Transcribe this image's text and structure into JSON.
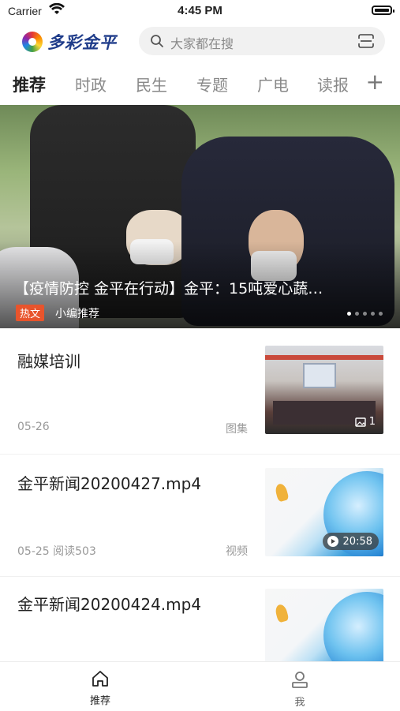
{
  "status": {
    "carrier": "Carrier",
    "time": "4:45 PM"
  },
  "header": {
    "logo_text": "多彩金平",
    "search_placeholder": "大家都在搜"
  },
  "tabs": [
    {
      "label": "推荐",
      "active": true
    },
    {
      "label": "时政"
    },
    {
      "label": "民生"
    },
    {
      "label": "专题"
    },
    {
      "label": "广电"
    },
    {
      "label": "读报"
    }
  ],
  "tab_add": "+",
  "banner": {
    "title": "【疫情防控 金平在行动】金平：15吨爱心蔬…",
    "badge": "热文",
    "source": "小编推荐"
  },
  "feed": [
    {
      "title": "融媒培训",
      "meta": "05-26",
      "type": "图集",
      "badge": "1"
    },
    {
      "title": "金平新闻20200427.mp4",
      "meta": "05-25  阅读503",
      "type": "视频",
      "duration": "20:58"
    },
    {
      "title": "金平新闻20200424.mp4"
    }
  ],
  "tabbar": [
    {
      "label": "推荐",
      "active": true
    },
    {
      "label": "我"
    }
  ],
  "colors": {
    "accent": "#222222",
    "badge": "#e8542c",
    "muted": "#999999"
  }
}
